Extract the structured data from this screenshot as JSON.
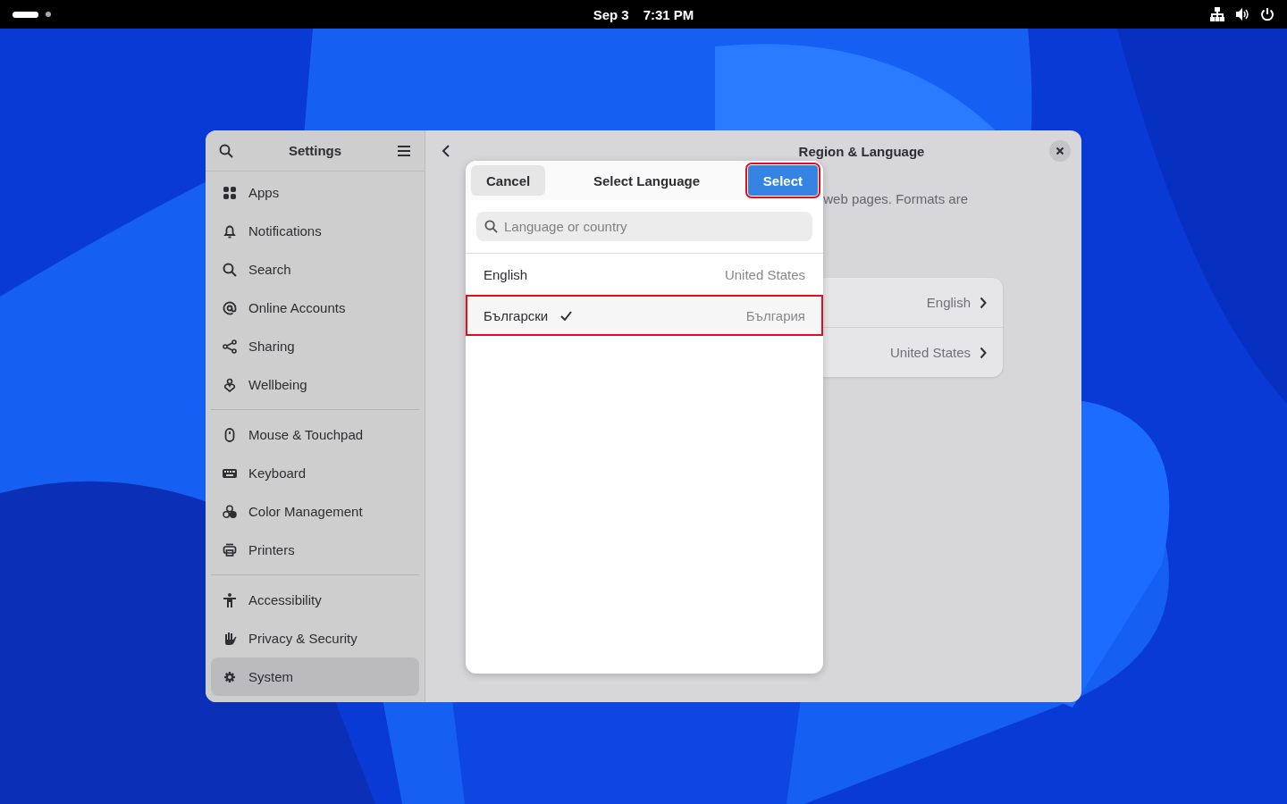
{
  "top_bar": {
    "date": "Sep 3",
    "time": "7:31 PM"
  },
  "sidebar": {
    "title": "Settings",
    "groups": [
      [
        {
          "label": "Apps",
          "selected": false
        },
        {
          "label": "Notifications",
          "selected": false
        },
        {
          "label": "Search",
          "selected": false
        },
        {
          "label": "Online Accounts",
          "selected": false
        },
        {
          "label": "Sharing",
          "selected": false
        },
        {
          "label": "Wellbeing",
          "selected": false
        }
      ],
      [
        {
          "label": "Mouse & Touchpad",
          "selected": false
        },
        {
          "label": "Keyboard",
          "selected": false
        },
        {
          "label": "Color Management",
          "selected": false
        },
        {
          "label": "Printers",
          "selected": false
        }
      ],
      [
        {
          "label": "Accessibility",
          "selected": false
        },
        {
          "label": "Privacy & Security",
          "selected": false
        },
        {
          "label": "System",
          "selected": true
        }
      ]
    ]
  },
  "main": {
    "title": "Region & Language",
    "description": "web pages. Formats are",
    "rows": [
      {
        "value": "English"
      },
      {
        "value": "United States"
      }
    ]
  },
  "dialog": {
    "title": "Select Language",
    "cancel": "Cancel",
    "select": {
      "label": "Select",
      "highlighted": true
    },
    "search": {
      "placeholder": "Language or country"
    },
    "languages": [
      {
        "name": "English",
        "country": "United States",
        "selected": false,
        "highlighted": false
      },
      {
        "name": "Български",
        "country": "България",
        "selected": true,
        "highlighted": true
      }
    ]
  }
}
